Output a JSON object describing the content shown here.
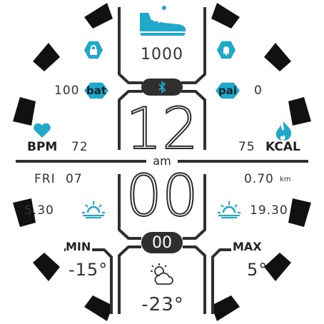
{
  "steps": {
    "value": "1000",
    "icon": "shoe-icon"
  },
  "battery": {
    "value": "100",
    "badge": "bat"
  },
  "pai": {
    "value": "0",
    "badge": "pai"
  },
  "heart": {
    "label": "BPM",
    "value": "72",
    "icon": "heart-icon"
  },
  "calories": {
    "value": "75",
    "label": "KCAL",
    "icon": "flame-icon"
  },
  "time": {
    "hour": "12",
    "minute": "00",
    "seconds": "00",
    "ampm": "am"
  },
  "date": {
    "weekday": "FRI",
    "day": "07"
  },
  "distance": {
    "value": "0.70",
    "unit": "km"
  },
  "sunrise": {
    "time": "5.30",
    "icon": "sunrise-icon"
  },
  "sunset": {
    "time": "19.30",
    "icon": "sunset-icon"
  },
  "weather": {
    "min_label": "MIN",
    "min_value": "-15°",
    "max_label": "MAX",
    "max_value": "5°",
    "current": "-23°",
    "icon": "partly-cloudy-icon"
  },
  "status": {
    "lock_icon": "lock-icon",
    "alarm_icon": "bell-icon",
    "bluetooth_icon": "bluetooth-icon"
  },
  "colors": {
    "accent": "#1fa8c8",
    "dark": "#2f2f2f",
    "bezel": "#111111"
  }
}
